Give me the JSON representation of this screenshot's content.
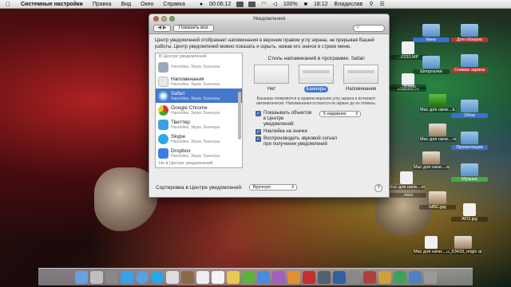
{
  "menubar": {
    "app_name": "Системные настройки",
    "menus": [
      "Правка",
      "Вид",
      "Окно",
      "Справка"
    ],
    "clock_left": "00:06:12",
    "battery": "100%",
    "clock": "18:12",
    "user": "Владислав"
  },
  "window": {
    "title": "Уведомления",
    "show_all": "Показать все",
    "description": "Центр уведомлений отображает напоминания в верхнем правом углу экрана, не прерывая Вашей работы. Центр уведомлений можно показать и скрыть, нажав его значок в строке меню.",
    "list_section_in": "В Центре уведомлений",
    "list_section_out": "Не в Центре уведомлений",
    "apps": [
      {
        "name": "",
        "sub": "Наклейки, Звуки, Баннеры",
        "icon_color": "#9ab"
      },
      {
        "name": "Напоминания",
        "sub": "Наклейки, Звуки, Баннеры",
        "icon_color": "#e8e8e8"
      },
      {
        "name": "Safari",
        "sub": "Наклейки, Звуки, Баннеры",
        "icon_color": "#5aa0e0"
      },
      {
        "name": "Google Chrome",
        "sub": "Наклейки, Звуки, Баннеры",
        "icon_color": "#e0c040"
      },
      {
        "name": "Твиттер",
        "sub": "Наклейки, Звуки, Баннеры",
        "icon_color": "#3aa0e8"
      },
      {
        "name": "Skype",
        "sub": "Наклейки, Звуки, Баннеры",
        "icon_color": "#28a8e8"
      },
      {
        "name": "Dropbox",
        "sub": "Наклейки, Звуки, Баннеры",
        "icon_color": "#3a7ee0"
      }
    ],
    "selected_app": "Safari",
    "style_title": "Стиль напоминаний в программе: Safari",
    "styles": [
      "Нет",
      "Баннеры",
      "Напоминания"
    ],
    "selected_style": "Баннеры",
    "style_note": "Баннеры появляются в правом верхнем углу экрана и исчезают автоматически. Напоминания остаются на экране до их отмены.",
    "opt_show": "Показывать объектов в Центре уведомлений:",
    "opt_show_value": "5 недавних",
    "opt_badge": "Наклейка на значке",
    "opt_sound": "Воспроизводить звуковой сигнал при получении уведомлений",
    "sort_label": "Сортировка в Центре уведомлений:",
    "sort_value": "Вручную",
    "help": "?"
  },
  "desktop_icons": [
    {
      "label": "Кино",
      "style": "sel"
    },
    {
      "label": "Для обзоров",
      "style": "red"
    },
    {
      "label": "...0233.MP",
      "style": ""
    },
    {
      "label": "Шпоргалки",
      "style": ""
    },
    {
      "label": "Снимки экрана",
      "style": "red"
    },
    {
      "label": "сование.m",
      "style": ""
    },
    {
      "label": "...rt.mov",
      "style": ""
    },
    {
      "label": "Мас для начи....k.mov",
      "style": ""
    },
    {
      "label": "Обои",
      "style": "sel"
    },
    {
      "label": "Мас для начи....ты.mov",
      "style": ""
    },
    {
      "label": "Презентации",
      "style": "sel"
    },
    {
      "label": "Мас для начи....ay.mov",
      "style": ""
    },
    {
      "label": "Мас для начи....ение.mov",
      "style": ""
    },
    {
      "label": "Музыка",
      "style": "grn"
    },
    {
      "label": ".mov",
      "style": ""
    },
    {
      "label": "ЫВС.jpg",
      "style": ""
    },
    {
      "label": "AFD.jpg",
      "style": ""
    },
    {
      "label": "Мас для начи....ры.mov",
      "style": ""
    },
    {
      "label": "..._53418_origin al.jpg",
      "style": ""
    }
  ]
}
